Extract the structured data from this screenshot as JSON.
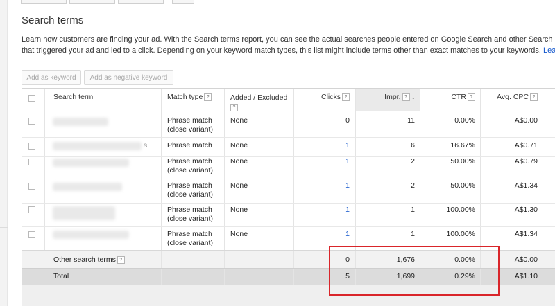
{
  "title": "Search terms",
  "description": {
    "line1": "Learn how customers are finding your ad. With the Search terms report, you can see the actual searches people entered on Google Search and other Search Netw",
    "line2": "that triggered your ad and led to a click. Depending on your keyword match types, this list might include terms other than exact matches to your keywords.",
    "link": "Learn m"
  },
  "toolbar": {
    "add_keyword": "Add as keyword",
    "add_negative": "Add as negative keyword"
  },
  "columns": {
    "search_term": "Search term",
    "match_type": "Match type",
    "added_excluded": "Added / Excluded",
    "clicks": "Clicks",
    "impr": "Impr.",
    "ctr": "CTR",
    "avg_cpc": "Avg. CPC",
    "help_icon": "?",
    "sort_icon": "↓"
  },
  "rows": [
    {
      "match_line1": "Phrase match",
      "match_line2": "(close variant)",
      "added": "None",
      "clicks": "0",
      "impr": "11",
      "ctr": "0.00%",
      "cpc": "A$0.00"
    },
    {
      "match_line1": "Phrase match",
      "match_line2": "",
      "added": "None",
      "clicks": "1",
      "impr": "6",
      "ctr": "16.67%",
      "cpc": "A$0.71",
      "term_suffix": "s"
    },
    {
      "match_line1": "Phrase match",
      "match_line2": "(close variant)",
      "added": "None",
      "clicks": "1",
      "impr": "2",
      "ctr": "50.00%",
      "cpc": "A$0.79"
    },
    {
      "match_line1": "Phrase match",
      "match_line2": "(close variant)",
      "added": "None",
      "clicks": "1",
      "impr": "2",
      "ctr": "50.00%",
      "cpc": "A$1.34"
    },
    {
      "match_line1": "Phrase match",
      "match_line2": "(close variant)",
      "added": "None",
      "clicks": "1",
      "impr": "1",
      "ctr": "100.00%",
      "cpc": "A$1.30"
    },
    {
      "match_line1": "Phrase match",
      "match_line2": "(close variant)",
      "added": "None",
      "clicks": "1",
      "impr": "1",
      "ctr": "100.00%",
      "cpc": "A$1.34"
    }
  ],
  "other": {
    "label": "Other search terms",
    "clicks": "0",
    "impr": "1,676",
    "ctr": "0.00%",
    "cpc": "A$0.00"
  },
  "total": {
    "label": "Total",
    "clicks": "5",
    "impr": "1,699",
    "ctr": "0.29%",
    "cpc": "A$1.10"
  },
  "colors": {
    "link": "#1155cc",
    "highlight": "#d9252a"
  }
}
